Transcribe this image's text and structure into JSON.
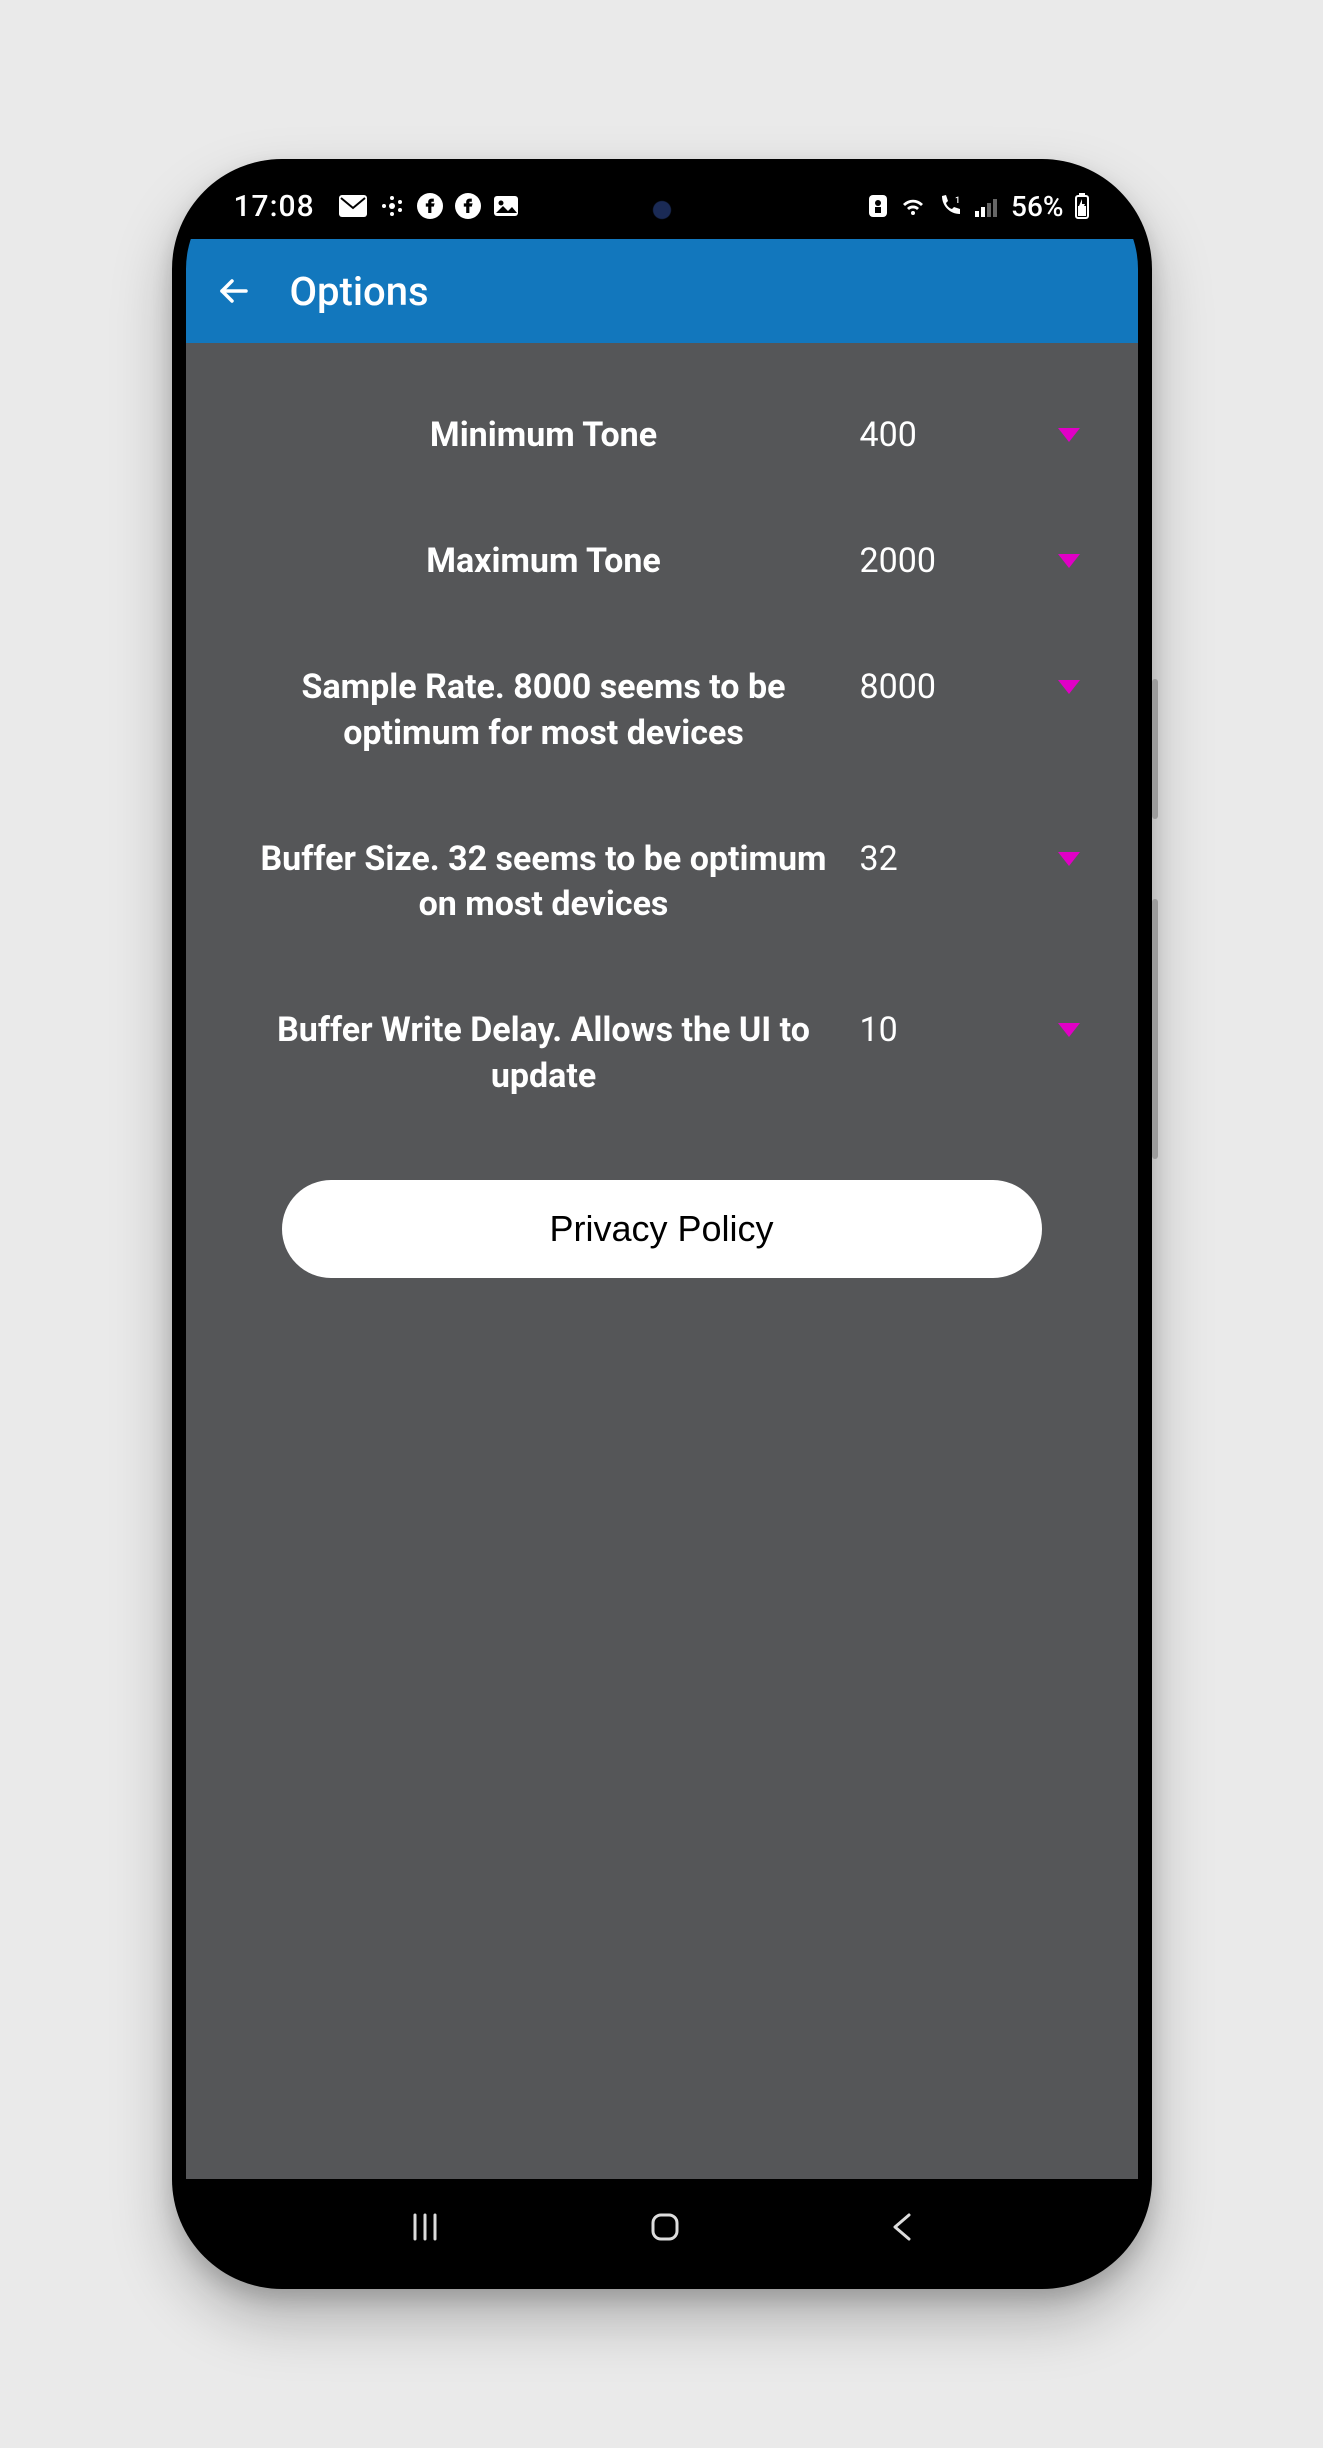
{
  "status": {
    "time": "17:08",
    "battery_text": "56%"
  },
  "appbar": {
    "title": "Options"
  },
  "options": [
    {
      "label": "Minimum Tone",
      "value": "400"
    },
    {
      "label": "Maximum Tone",
      "value": "2000"
    },
    {
      "label": "Sample Rate. 8000 seems to be optimum for most devices",
      "value": "8000"
    },
    {
      "label": "Buffer Size. 32 seems to be optimum on most devices",
      "value": "32"
    },
    {
      "label": "Buffer Write Delay. Allows the UI to update",
      "value": "10"
    }
  ],
  "buttons": {
    "privacy": "Privacy Policy"
  }
}
